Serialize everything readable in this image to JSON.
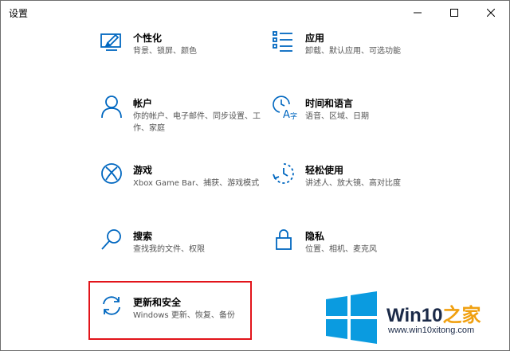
{
  "window": {
    "title": "设置"
  },
  "settings": {
    "personalization": {
      "name": "个性化",
      "desc": "背景、锁屏、颜色",
      "icon": "personalization-icon"
    },
    "apps": {
      "name": "应用",
      "desc": "卸载、默认应用、可选功能",
      "icon": "apps-list-icon"
    },
    "accounts": {
      "name": "帐户",
      "desc": "你的帐户、电子邮件、同步设置、工作、家庭",
      "icon": "person-icon"
    },
    "time_language": {
      "name": "时间和语言",
      "desc": "语音、区域、日期",
      "icon": "time-language-icon"
    },
    "gaming": {
      "name": "游戏",
      "desc": "Xbox Game Bar、捕获、游戏模式",
      "icon": "xbox-icon"
    },
    "ease_of_access": {
      "name": "轻松使用",
      "desc": "讲述人、放大镜、高对比度",
      "icon": "ease-of-access-icon"
    },
    "search": {
      "name": "搜索",
      "desc": "查找我的文件、权限",
      "icon": "search-icon"
    },
    "privacy": {
      "name": "隐私",
      "desc": "位置、相机、麦克风",
      "icon": "lock-icon"
    },
    "update_security": {
      "name": "更新和安全",
      "desc": "Windows 更新、恢复、备份",
      "icon": "sync-icon"
    }
  },
  "watermark": {
    "brand": "Win10",
    "brand_accent": "之家",
    "url": "www.win10xitong.com"
  },
  "colors": {
    "icon_blue": "#0067c0",
    "highlight_red": "#e2141a",
    "window_border": "#6e6e6e"
  }
}
